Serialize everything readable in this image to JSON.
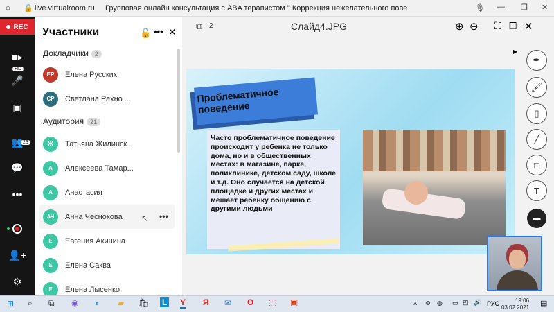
{
  "browser": {
    "url": "live.virtualroom.ru",
    "title": "Групповая онлайн консультация с ABA терапистом \" Коррекция нежелательного поведения\"."
  },
  "rail": {
    "rec_label": "REC",
    "hd_label": "HD",
    "participants_count": "23"
  },
  "panel": {
    "title": "Участники",
    "speakers_label": "Докладчики",
    "speakers_count": "2",
    "audience_label": "Аудитория",
    "audience_count": "21",
    "speakers": [
      {
        "initials": "ЕР",
        "name": "Елена Русских",
        "color": "#c0392b"
      },
      {
        "initials": "СР",
        "name": "Светлана Рахно ...",
        "color": "#2f6e7d"
      }
    ],
    "audience": [
      {
        "initials": "Ж",
        "name": "Татьяна Жилинск...",
        "color": "#3ec7a4"
      },
      {
        "initials": "А",
        "name": "Алексеева Тамар...",
        "color": "#3ec7a4"
      },
      {
        "initials": "А",
        "name": "Анастасия",
        "color": "#3ec7a4"
      },
      {
        "initials": "АЧ",
        "name": "Анна Чеснокова",
        "color": "#3ec7a4"
      },
      {
        "initials": "Е",
        "name": "Евгения Акинина",
        "color": "#3ec7a4"
      },
      {
        "initials": "Е",
        "name": "Елена Саква",
        "color": "#3ec7a4"
      },
      {
        "initials": "Е",
        "name": "Елена Лысенко",
        "color": "#3ec7a4"
      }
    ]
  },
  "main": {
    "pages_count": "2",
    "file_name": "Слайд4.JPG"
  },
  "slide": {
    "heading": "Проблематичное поведение",
    "body": "Часто проблематичное поведение происходит у ребенка не только дома, но и в общественных местах: в магазине, парке, поликлинике, детском саду, школе и т.д. Оно случается на детской площадке и других местах и мешает ребенку общению с другими людьми"
  },
  "taskbar": {
    "language": "РУС",
    "time": "19:06",
    "date": "03.02.2021"
  }
}
